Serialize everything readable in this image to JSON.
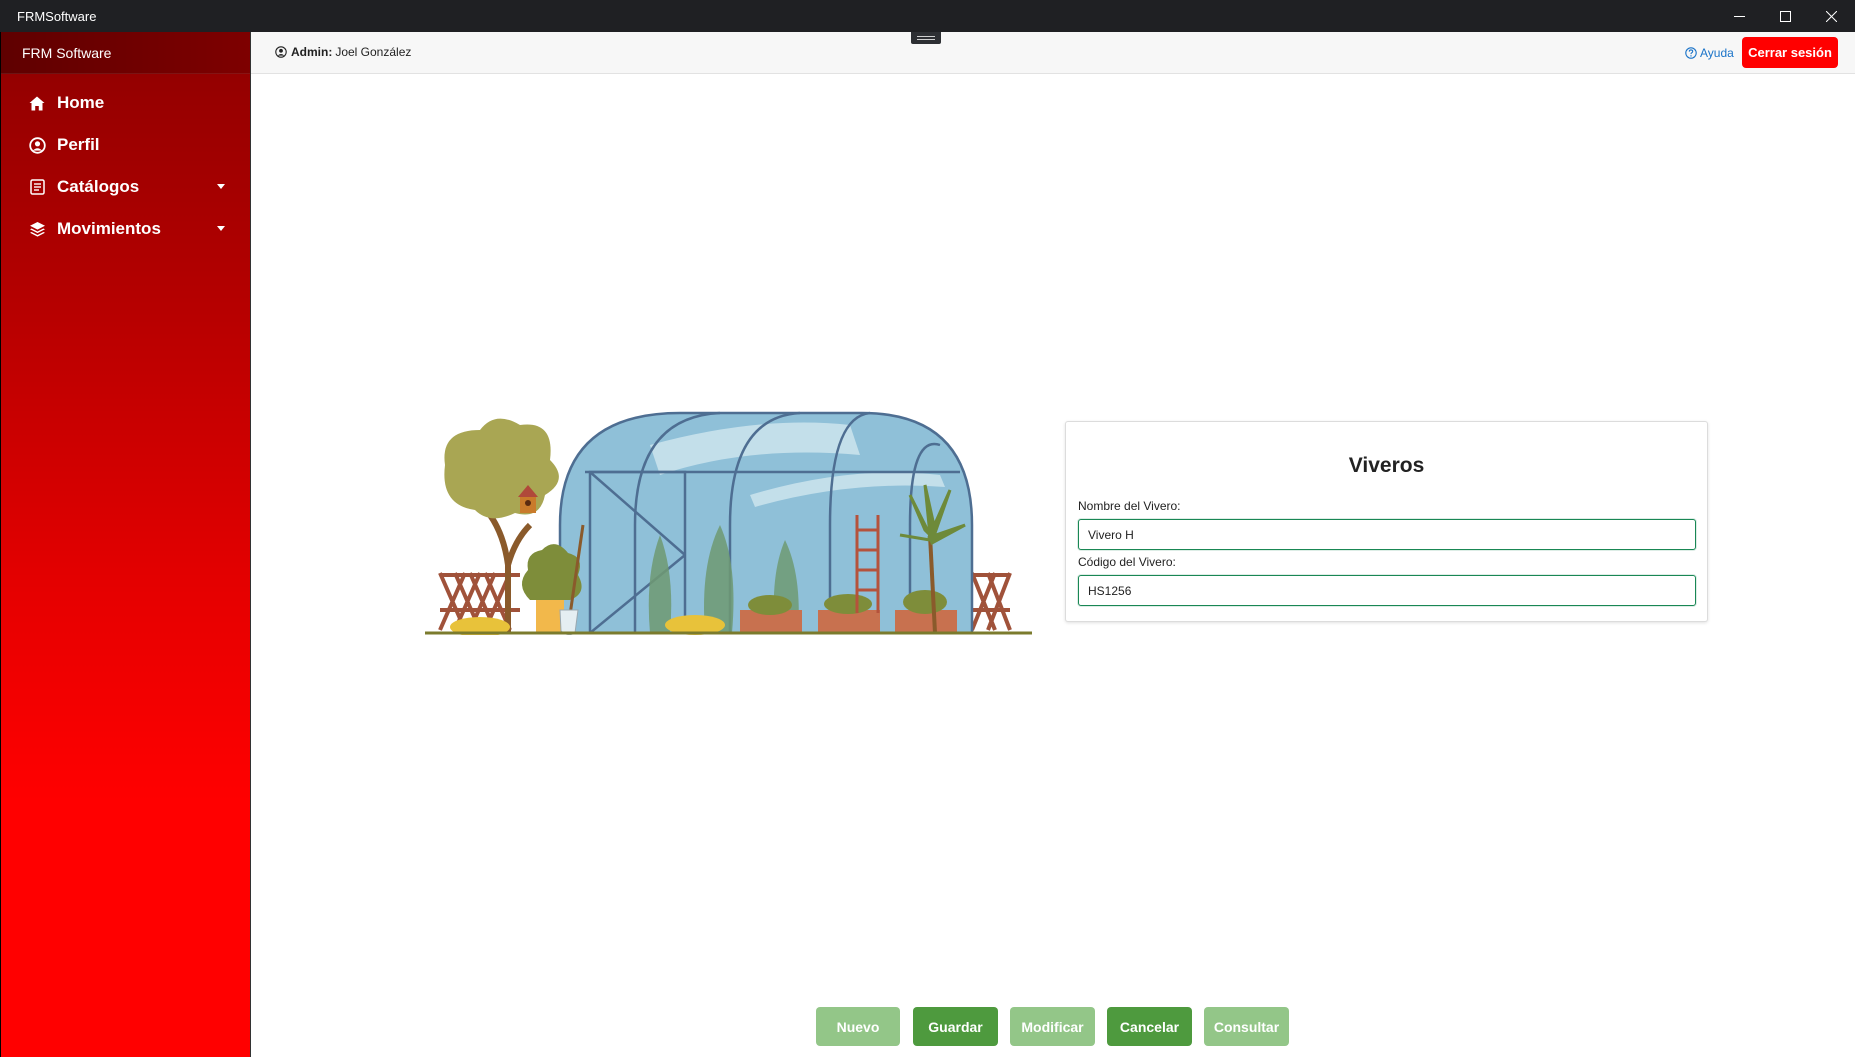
{
  "window": {
    "title": "FRMSoftware"
  },
  "sidebar": {
    "brand": "FRM Software",
    "items": [
      {
        "label": "Home",
        "icon": "home-icon",
        "has_submenu": false
      },
      {
        "label": "Perfil",
        "icon": "user-circle-icon",
        "has_submenu": false
      },
      {
        "label": "Catálogos",
        "icon": "catalog-icon",
        "has_submenu": true
      },
      {
        "label": "Movimientos",
        "icon": "layers-icon",
        "has_submenu": true
      }
    ]
  },
  "header": {
    "user_role": "Admin:",
    "user_name": "Joel González",
    "help_label": "Ayuda",
    "logout_label": "Cerrar sesión"
  },
  "form": {
    "title": "Viveros",
    "name_label": "Nombre del Vivero:",
    "name_value": "Vivero H",
    "code_label": "Código del Vivero:",
    "code_value": "HS1256"
  },
  "actions": {
    "new_label": "Nuevo",
    "save_label": "Guardar",
    "modify_label": "Modificar",
    "cancel_label": "Cancelar",
    "query_label": "Consultar"
  },
  "colors": {
    "sidebar_top": "#8e0000",
    "sidebar_bottom": "#ff0000",
    "logout": "#ff0000",
    "button_active": "#4e9a3e",
    "button_disabled": "#93c688",
    "input_border": "#198754",
    "help_link": "#1a73c8"
  }
}
